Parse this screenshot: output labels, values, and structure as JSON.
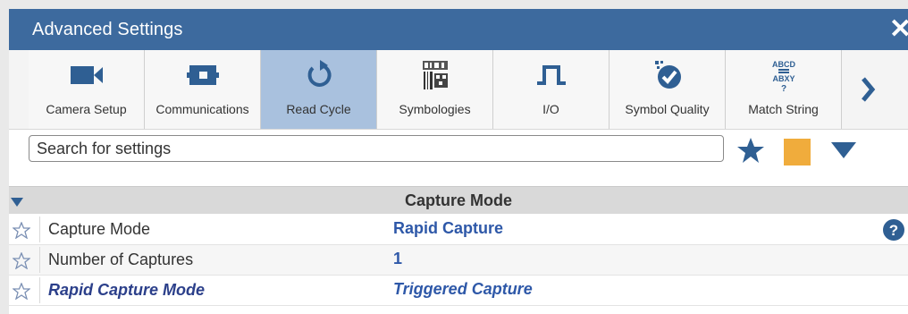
{
  "window": {
    "title": "Advanced Settings",
    "close_icon": "close-icon"
  },
  "toolbar": {
    "items": [
      {
        "label": "Camera Setup",
        "icon": "video-camera-icon",
        "active": false
      },
      {
        "label": "Communications",
        "icon": "plug-connector-icon",
        "active": false
      },
      {
        "label": "Read Cycle",
        "icon": "refresh-icon",
        "active": true
      },
      {
        "label": "Symbologies",
        "icon": "barcode-icon",
        "active": false
      },
      {
        "label": "I/O",
        "icon": "pulse-wave-icon",
        "active": false
      },
      {
        "label": "Symbol Quality",
        "icon": "quality-badge-icon",
        "active": false
      },
      {
        "label": "Match String",
        "icon": "match-string-icon",
        "active": false
      }
    ],
    "next_icon": "chevron-right-icon"
  },
  "search": {
    "placeholder": "Search for settings",
    "value": ""
  },
  "colors": {
    "title_bar": "#3d6a9e",
    "active_tab": "#a9c1de",
    "value_text": "#2e58a8",
    "orange_square": "#f0ac3c"
  },
  "section": {
    "title": "Capture Mode"
  },
  "rows": [
    {
      "name": "Capture Mode",
      "value": "Rapid Capture"
    },
    {
      "name": "Number of Captures",
      "value": "1"
    },
    {
      "name": "Rapid Capture Mode",
      "value": "Triggered Capture"
    }
  ]
}
